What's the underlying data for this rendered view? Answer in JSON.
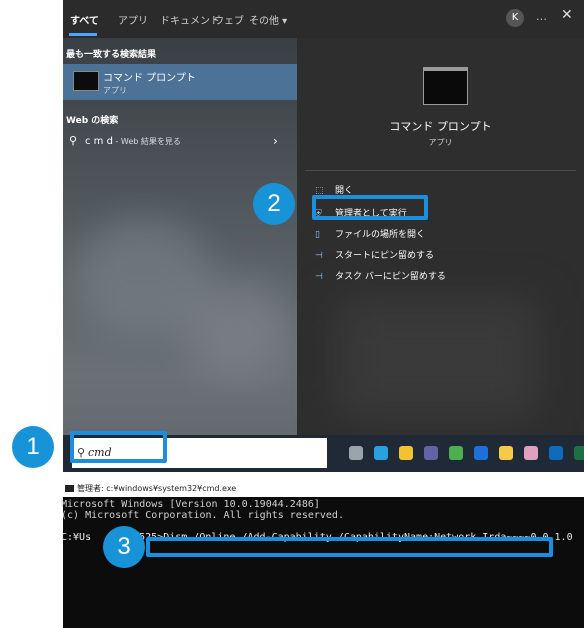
{
  "start_menu": {
    "tabs": [
      {
        "label": "すべて",
        "active": true
      },
      {
        "label": "アプリ"
      },
      {
        "label": "ドキュメント"
      },
      {
        "label": "ウェブ"
      },
      {
        "label": "その他 ▾"
      }
    ],
    "avatar_letter": "K",
    "more_icon": "…",
    "close_icon": "✕",
    "best_match": {
      "heading": "最も一致する検索結果",
      "title": "コマンド プロンプト",
      "subtitle": "アプリ"
    },
    "web": {
      "heading": "Web の検索",
      "query": "c m d",
      "suffix": " - Web 結果を見る"
    },
    "preview": {
      "title": "コマンド プロンプト",
      "subtitle": "アプリ"
    },
    "actions": [
      {
        "icon": "open-icon",
        "glyph": "⬚",
        "label": "開く"
      },
      {
        "icon": "admin-shield-icon",
        "glyph": "⛨",
        "label": "管理者として実行"
      },
      {
        "icon": "folder-icon",
        "glyph": "▯",
        "label": "ファイルの場所を開く"
      },
      {
        "icon": "pin-start-icon",
        "glyph": "⊣",
        "label": "スタートにピン留めする"
      },
      {
        "icon": "pin-taskbar-icon",
        "glyph": "⊣",
        "label": "タスク バーにピン留めする"
      }
    ]
  },
  "taskbar": {
    "search_value": "cmd",
    "icons": [
      {
        "name": "task-view-icon",
        "color": "#9aa4ad"
      },
      {
        "name": "edge-icon",
        "color": "#2aa0e0"
      },
      {
        "name": "file-explorer-icon",
        "color": "#f2c230"
      },
      {
        "name": "teams-icon",
        "color": "#6264a7"
      },
      {
        "name": "chrome-icon",
        "color": "#4caf50"
      },
      {
        "name": "app-blue-icon",
        "color": "#1e6fd9"
      },
      {
        "name": "sticky-notes-icon",
        "color": "#f7c948"
      },
      {
        "name": "paint-icon",
        "color": "#e0a0c0"
      },
      {
        "name": "outlook-icon",
        "color": "#0f6cbd"
      },
      {
        "name": "excel-icon",
        "color": "#1d7044"
      }
    ]
  },
  "console": {
    "title": "管理者: c:¥windows¥system32¥cmd.exe",
    "line1": "Microsoft Windows [Version 10.0.19044.2486]",
    "line2": "(c) Microsoft Corporation. All rights reserved.",
    "prompt_prefix": "C:¥Us",
    "prompt_mid": "52",
    "command": "5>Dism /Online /Add-Capability /CapabilityName:Network.Irda~~~~0.0.1.0"
  },
  "annotations": {
    "step1": "1",
    "step2": "2",
    "step3": "3"
  }
}
